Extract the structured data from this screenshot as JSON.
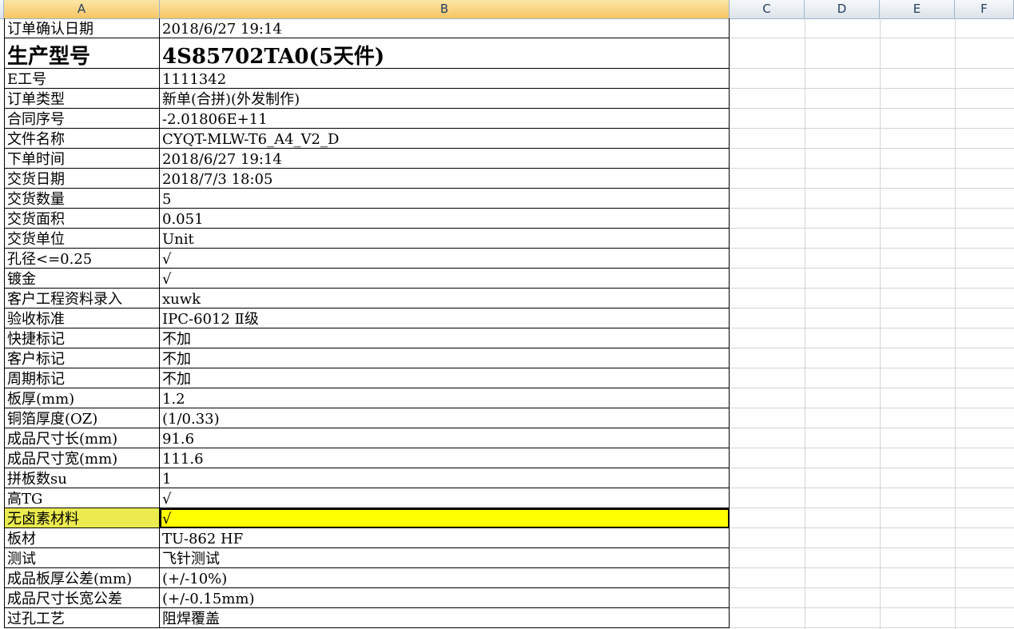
{
  "columns": [
    "A",
    "B",
    "C",
    "D",
    "E",
    "F"
  ],
  "rows": [
    {
      "a": "订单确认日期",
      "b": "2018/6/27 19:14"
    },
    {
      "a": "生产型号",
      "b": "4S85702TA0(5天件)"
    },
    {
      "a": "E工号",
      "b": "1111342"
    },
    {
      "a": "订单类型",
      "b": "新单(合拼)(外发制作)"
    },
    {
      "a": "合同序号",
      "b": "-2.01806E+11"
    },
    {
      "a": "文件名称",
      "b": "CYQT-MLW-T6_A4_V2_D"
    },
    {
      "a": "下单时间",
      "b": "2018/6/27 19:14"
    },
    {
      "a": "交货日期",
      "b": "2018/7/3 18:05"
    },
    {
      "a": "交货数量",
      "b": "5"
    },
    {
      "a": "交货面积",
      "b": "0.051"
    },
    {
      "a": "交货单位",
      "b": "Unit"
    },
    {
      "a": "孔径<=0.25",
      "b": "√"
    },
    {
      "a": "镀金",
      "b": "√"
    },
    {
      "a": "客户工程资料录入",
      "b": "xuwk"
    },
    {
      "a": "验收标准",
      "b": "IPC-6012 Ⅱ级"
    },
    {
      "a": "快捷标记",
      "b": "不加"
    },
    {
      "a": "客户标记",
      "b": "不加"
    },
    {
      "a": "周期标记",
      "b": "不加"
    },
    {
      "a": "板厚(mm)",
      "b": "1.2"
    },
    {
      "a": "铜箔厚度(OZ)",
      "b": "(1/0.33)"
    },
    {
      "a": "成品尺寸长(mm)",
      "b": "91.6"
    },
    {
      "a": "成品尺寸宽(mm)",
      "b": "111.6"
    },
    {
      "a": "拼板数su",
      "b": "1"
    },
    {
      "a": "高TG",
      "b": "√"
    },
    {
      "a": "无卤素材料",
      "b": "√"
    },
    {
      "a": "板材",
      "b": "TU-862 HF"
    },
    {
      "a": "测试",
      "b": "飞针测试"
    },
    {
      "a": "成品板厚公差(mm)",
      "b": "(+/-10%)"
    },
    {
      "a": "成品尺寸长宽公差",
      "b": "(+/-0.15mm)"
    },
    {
      "a": "过孔工艺",
      "b": "阻焊覆盖"
    }
  ],
  "colors": {
    "highlight": "#ffff00",
    "header_selected": "#f6c565",
    "gridline": "#d4d4d4"
  }
}
